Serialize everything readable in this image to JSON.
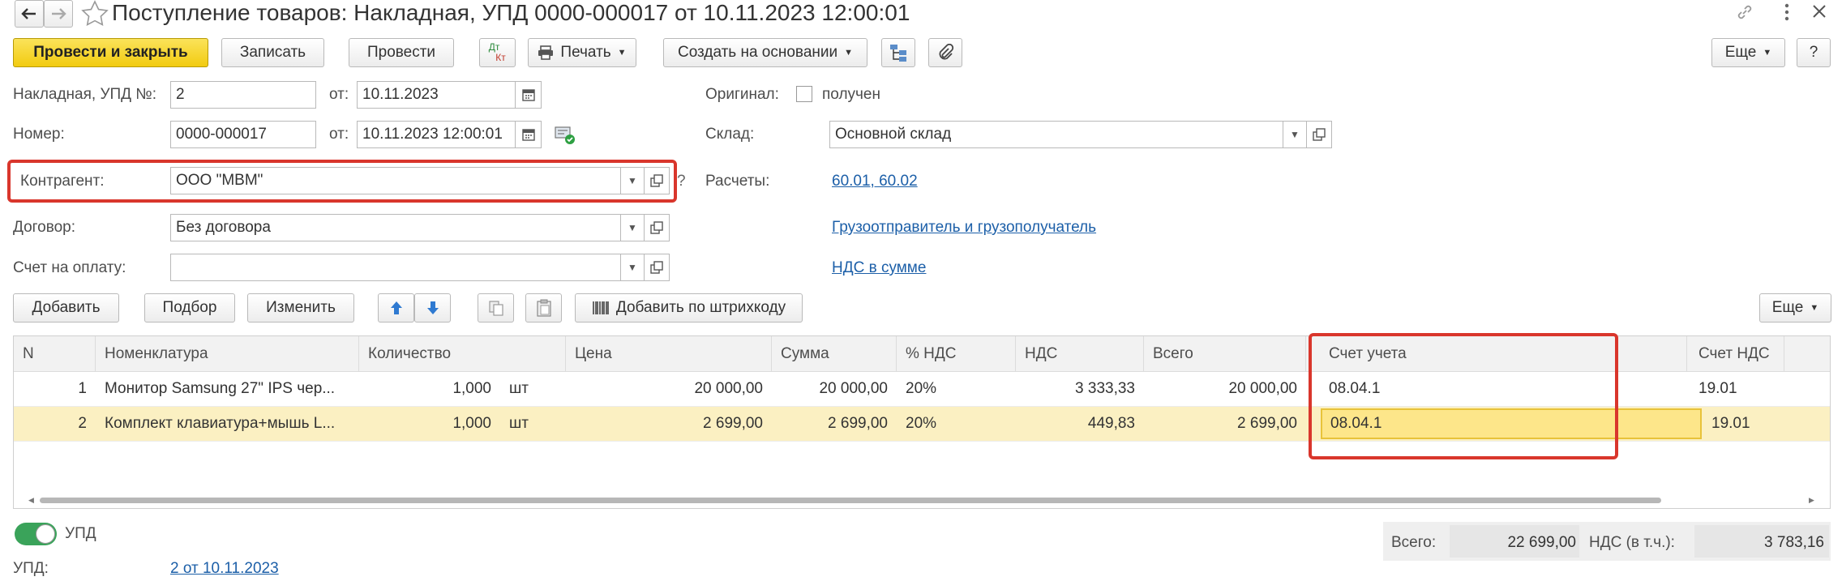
{
  "window": {
    "title": "Поступление товаров: Накладная, УПД 0000-000017 от 10.11.2023 12:00:01"
  },
  "toolbar": {
    "post_close": "Провести и закрыть",
    "save": "Записать",
    "post": "Провести",
    "dt_kt_top": "Дт",
    "dt_kt_bottom": "Кт",
    "print": "Печать",
    "create_based": "Создать на основании",
    "more": "Еще",
    "help": "?"
  },
  "header": {
    "invoice_label": "Накладная, УПД №:",
    "invoice_value": "2",
    "from_label": "от:",
    "invoice_date": "10.11.2023",
    "number_label": "Номер:",
    "number_value": "0000-000017",
    "number_date": "10.11.2023 12:00:01",
    "original_label": "Оригинал:",
    "original_received": "получен",
    "warehouse_label": "Склад:",
    "warehouse_value": "Основной склад",
    "counterparty_label": "Контрагент:",
    "counterparty_value": "ООО \"МВМ\"",
    "question": "?",
    "settlements_label": "Расчеты:",
    "settlements_link": "60.01, 60.02",
    "contract_label": "Договор:",
    "contract_value": "Без договора",
    "shipper_link": "Грузоотправитель и грузополучатель",
    "invoice_pay_label": "Счет на оплату:",
    "invoice_pay_value": "",
    "vat_link": "НДС в сумме"
  },
  "table_toolbar": {
    "add": "Добавить",
    "select": "Подбор",
    "change": "Изменить",
    "barcode": "Добавить по штрихкоду",
    "more": "Еще"
  },
  "table": {
    "headers": [
      "N",
      "Номенклатура",
      "Количество",
      "Цена",
      "Сумма",
      "% НДС",
      "НДС",
      "Всего",
      "Счет учета",
      "Счет НДС"
    ],
    "rows": [
      {
        "n": "1",
        "name": "Монитор Samsung 27\" IPS чер...",
        "qty": "1,000",
        "unit": "шт",
        "price": "20 000,00",
        "sum": "20 000,00",
        "vat_rate": "20%",
        "vat": "3 333,33",
        "total": "20 000,00",
        "account": "08.04.1",
        "vat_account": "19.01"
      },
      {
        "n": "2",
        "name": "Комплект клавиатура+мышь L...",
        "qty": "1,000",
        "unit": "шт",
        "price": "2 699,00",
        "sum": "2 699,00",
        "vat_rate": "20%",
        "vat": "449,83",
        "total": "2 699,00",
        "account": "08.04.1",
        "vat_account": "19.01"
      }
    ]
  },
  "footer": {
    "upd_toggle_label": "УПД",
    "upd_label": "УПД:",
    "upd_link": "2 от 10.11.2023",
    "total_label": "Всего:",
    "total_value": "22 699,00",
    "vat_label": "НДС (в т.ч.):",
    "vat_value": "3 783,16"
  },
  "colors": {
    "accent_yellow": "#f4d125",
    "highlight_red": "#d9362c",
    "link_blue": "#1c5fa8",
    "selected_row": "#fbf0c2",
    "active_cell": "#fde68a",
    "toggle_green": "#3aa35a"
  }
}
